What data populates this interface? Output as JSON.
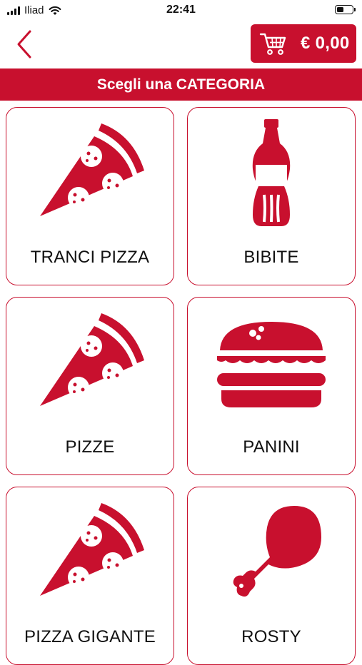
{
  "status_bar": {
    "carrier": "Iliad",
    "time": "22:41",
    "battery_level": 0.45
  },
  "header": {
    "back_icon": "chevron-left-icon",
    "cart_icon": "shopping-cart-icon",
    "cart_total": "€ 0,00"
  },
  "category_bar": {
    "title": "Scegli una CATEGORIA"
  },
  "categories": [
    {
      "label": "TRANCI PIZZA",
      "icon": "pizza-slice-icon"
    },
    {
      "label": "BIBITE",
      "icon": "soda-bottle-icon"
    },
    {
      "label": "PIZZE",
      "icon": "pizza-slice-icon"
    },
    {
      "label": "PANINI",
      "icon": "burger-icon"
    },
    {
      "label": "PIZZA GIGANTE",
      "icon": "pizza-slice-icon"
    },
    {
      "label": "ROSTY",
      "icon": "chicken-leg-icon"
    }
  ],
  "colors": {
    "brand_red": "#c8102e",
    "text": "#111111",
    "background": "#ffffff"
  }
}
